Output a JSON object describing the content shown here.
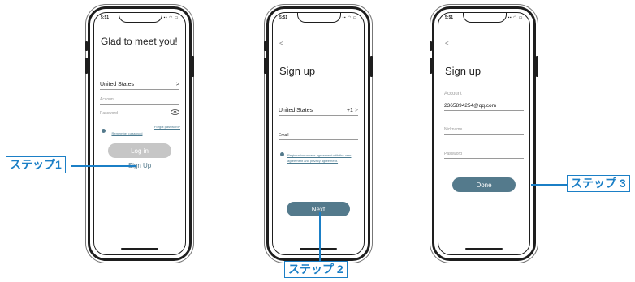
{
  "phone1": {
    "time": "5:51",
    "title": "Glad to meet you!",
    "country": "United States",
    "country_chevron": ">",
    "account_placeholder": "Account",
    "password_placeholder": "Password",
    "remember": "Remember password",
    "forgot": "Forgot password?",
    "login_label": "Log in",
    "signup_link": "Sign Up"
  },
  "phone2": {
    "time": "5:51",
    "back": "<",
    "title": "Sign up",
    "country": "United States",
    "code": "+1",
    "chevron": ">",
    "email_label": "Email",
    "agreement_line1": "Registration means agreement with the user",
    "agreement_line2": "agreement and privacy agreement.",
    "next_label": "Next"
  },
  "phone3": {
    "time": "5:51",
    "back": "<",
    "title": "Sign up",
    "account_label": "Account",
    "account_value": "2365894254@qq.com",
    "nickname_placeholder": "Nickname",
    "password_placeholder": "Password",
    "done_label": "Done"
  },
  "callouts": {
    "step1": "ステップ1",
    "step2": "ステップ 2",
    "step3": "ステップ 3"
  },
  "colors": {
    "accent": "#547a8c",
    "callout": "#1b7fc6",
    "disabled_button": "#c6c6c6"
  }
}
